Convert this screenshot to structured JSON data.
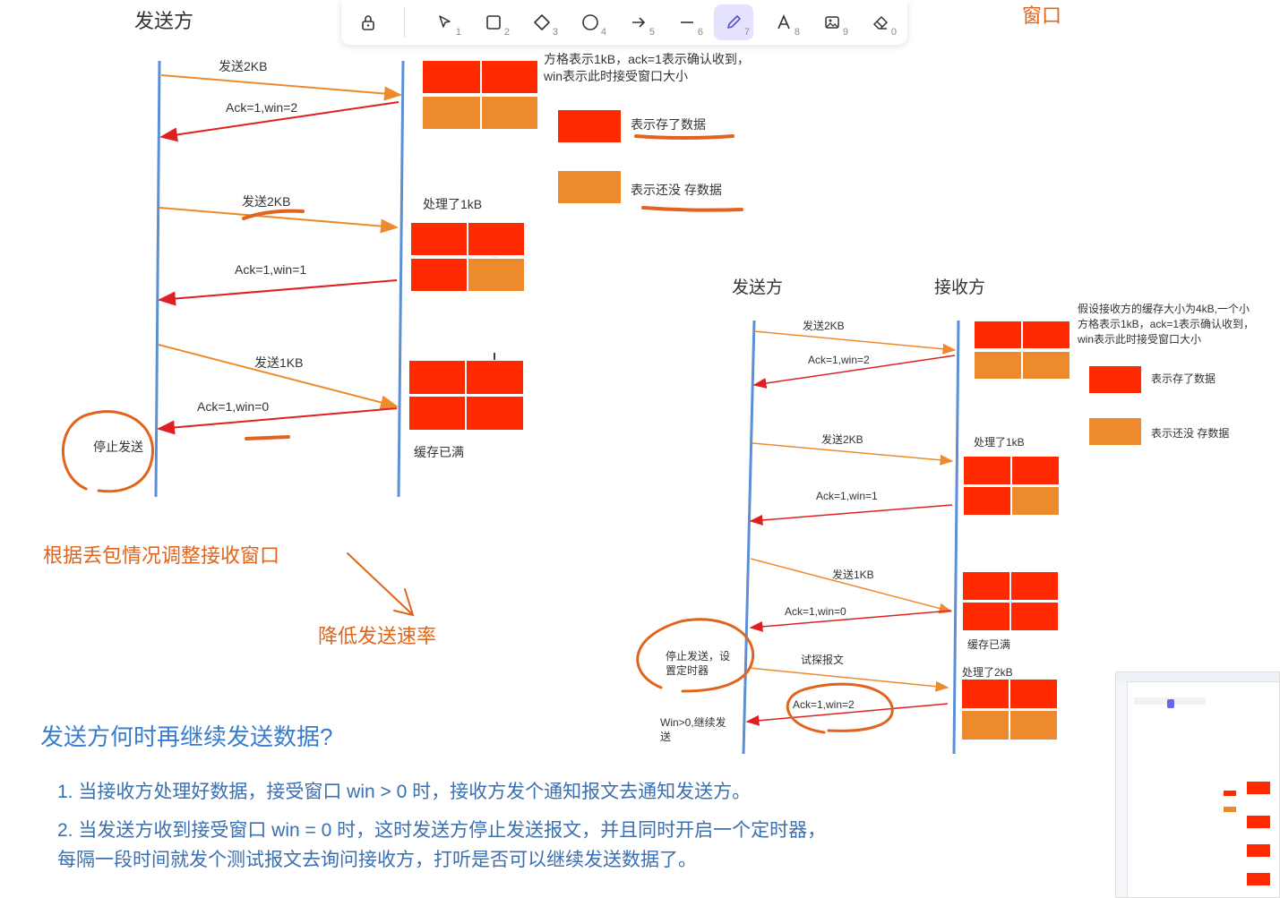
{
  "toolbar": {
    "tools": [
      {
        "icon": "lock-icon",
        "num": ""
      },
      {
        "icon": "cursor-icon",
        "num": "1"
      },
      {
        "icon": "rectangle-icon",
        "num": "2"
      },
      {
        "icon": "diamond-icon",
        "num": "3"
      },
      {
        "icon": "ellipse-icon",
        "num": "4"
      },
      {
        "icon": "arrow-icon",
        "num": "5"
      },
      {
        "icon": "line-icon",
        "num": "6"
      },
      {
        "icon": "pencil-icon",
        "num": "7"
      },
      {
        "icon": "text-icon",
        "num": "8"
      },
      {
        "icon": "image-icon",
        "num": "9"
      },
      {
        "icon": "eraser-icon",
        "num": "0"
      }
    ],
    "active_tool": "pencil-icon"
  },
  "left": {
    "sender_title": "发送方",
    "window_title": "窗口",
    "msgs": [
      "发送2KB",
      "Ack=1,win=2",
      "发送2KB",
      "Ack=1,win=1",
      "发送1KB",
      "Ack=1,win=0"
    ],
    "processed": "处理了1kB",
    "buffer_full": "缓存已满",
    "stop_send": "停止发送",
    "note_line1": "方格表示1kB，ack=1表示确认收到，",
    "note_line2": "win表示此时接受窗口大小",
    "legend_stored": "表示存了数据",
    "legend_empty": "表示还没 存数据"
  },
  "right": {
    "sender": "发送方",
    "receiver": "接收方",
    "note": [
      "假设接收方的缓存大小为4kB,一个小",
      "方格表示1kB，ack=1表示确认收到，",
      "win表示此时接受窗口大小"
    ],
    "legend_stored": "表示存了数据",
    "legend_empty": "表示还没 存数据",
    "msgs": [
      "发送2KB",
      "Ack=1,win=2",
      "发送2KB",
      "Ack=1,win=1",
      "发送1KB",
      "Ack=1,win=0",
      "试探报文",
      "Ack=1,win=2"
    ],
    "processed_1": "处理了1kB",
    "buffer_full": "缓存已满",
    "processed_2": "处理了2kB",
    "stop_timer": [
      "停止发送，设",
      "置定时器"
    ],
    "win_continue": [
      "Win>0,继续发",
      "送"
    ]
  },
  "body": {
    "adjust": "根据丢包情况调整接收窗口",
    "reduce": "降低发送速率",
    "question": "发送方何时再继续发送数据?",
    "point1": "1. 当接收方处理好数据，接受窗口 win > 0 时，接收方发个通知报文去通知发送方。",
    "point2a": "2. 当发送方收到接受窗口 win = 0 时，这时发送方停止发送报文，并且同时开启一个定时器，",
    "point2b": "每隔一段时间就发个测试报文去询问接收方，打听是否可以继续发送数据了。"
  },
  "colors": {
    "stored": "#ff2a00",
    "empty": "#ee8a2e",
    "send_arrow": "#ee8a2e",
    "ack_arrow": "#e02020",
    "lifeline": "#5b8fd6",
    "ink": "#e0641c"
  }
}
